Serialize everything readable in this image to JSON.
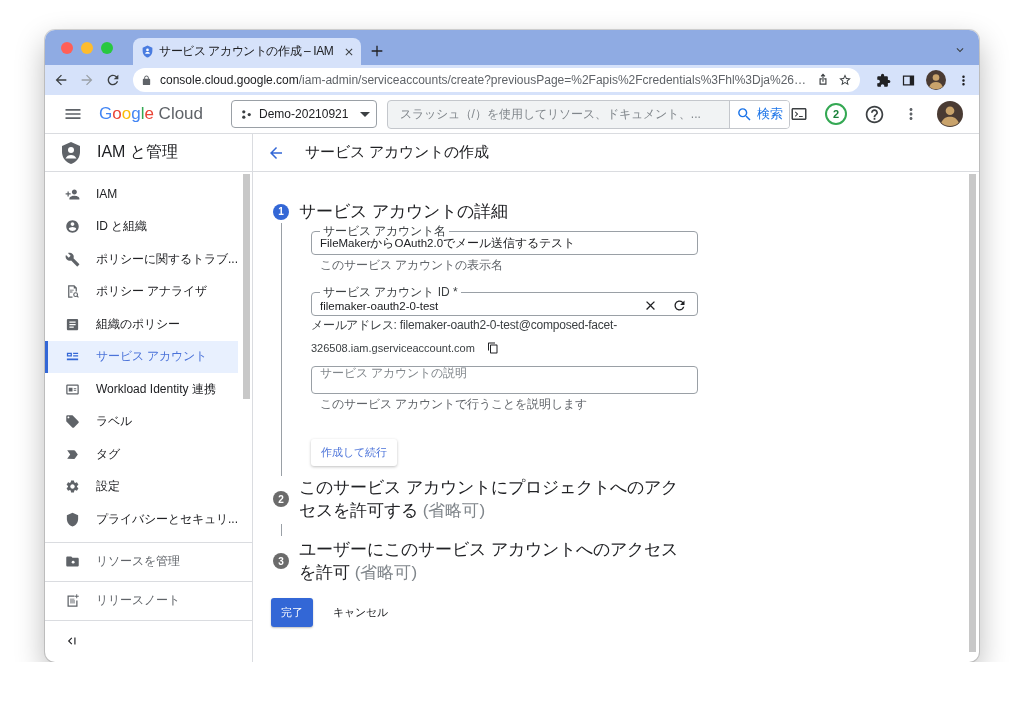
{
  "browser": {
    "tab_title": "サービス アカウントの作成 – IAM",
    "url_host": "console.cloud.google.com",
    "url_path": "/iam-admin/serviceaccounts/create?previousPage=%2Fapis%2Fcredentials%3Fhl%3Dja%26…"
  },
  "header": {
    "logo_google": "Google",
    "logo_cloud": "Cloud",
    "project": "Demo-20210921",
    "search_placeholder": "スラッシュ（/）を使用してリソース、ドキュメント、...",
    "search_button": "検索",
    "notifications": "2"
  },
  "sidebar": {
    "title": "IAM と管理",
    "items": [
      {
        "label": "IAM",
        "kind": "person-add",
        "selected": false
      },
      {
        "label": "ID と組織",
        "kind": "account",
        "selected": false
      },
      {
        "label": "ポリシーに関するトラブ...",
        "kind": "wrench",
        "selected": false
      },
      {
        "label": "ポリシー アナライザ",
        "kind": "doc-search",
        "selected": false
      },
      {
        "label": "組織のポリシー",
        "kind": "article",
        "selected": false
      },
      {
        "label": "サービス アカウント",
        "kind": "service-account",
        "selected": true
      },
      {
        "label": "Workload Identity 連携",
        "kind": "id-card",
        "selected": false
      },
      {
        "label": "ラベル",
        "kind": "tag",
        "selected": false
      },
      {
        "label": "タグ",
        "kind": "chevron-tag",
        "selected": false
      },
      {
        "label": "設定",
        "kind": "gear",
        "selected": false
      },
      {
        "label": "プライバシーとセキュリ...",
        "kind": "shield",
        "selected": false
      }
    ],
    "footer_items": [
      {
        "label": "リソースを管理",
        "kind": "folder"
      },
      {
        "label": "リリースノート",
        "kind": "notes"
      }
    ]
  },
  "page": {
    "title": "サービス アカウントの作成"
  },
  "steps": [
    {
      "number": "1",
      "title": "サービス アカウントの詳細",
      "active": true
    },
    {
      "number": "2",
      "title": "このサービス アカウントにプロジェクトへのアクセスを許可する",
      "optional": "(省略可)",
      "active": false
    },
    {
      "number": "3",
      "title": "ユーザーにこのサービス アカウントへのアクセスを許可",
      "optional": "(省略可)",
      "active": false
    }
  ],
  "details": {
    "fields": [
      {
        "kind": "name",
        "label": "サービス アカウント名",
        "value": "FileMakerからOAuth2.0でメール送信するテスト",
        "hint": "このサービス アカウントの表示名"
      },
      {
        "kind": "id",
        "label": "サービス アカウント ID *",
        "value": "filemaker-oauth2-0-test",
        "email_line1": "メールアドレス: filemaker-oauth2-0-test@composed-facet-",
        "email_line2": "326508.iam.gserviceaccount.com"
      },
      {
        "kind": "description",
        "placeholder": "サービス アカウントの説明",
        "hint": "このサービス アカウントで行うことを説明します"
      }
    ],
    "create_button": "作成して続行"
  },
  "actions": {
    "done": "完了",
    "cancel": "キャンセル"
  }
}
